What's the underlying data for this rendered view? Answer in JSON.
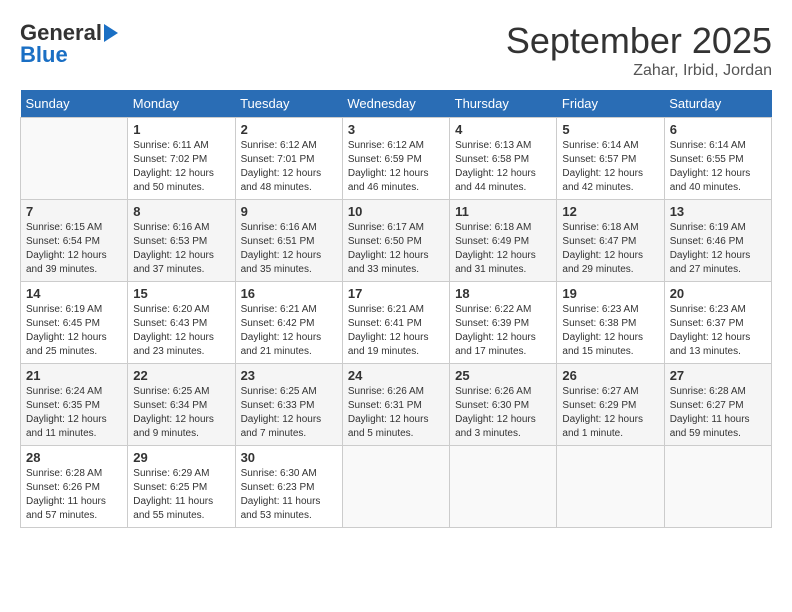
{
  "logo": {
    "line1": "General",
    "line2": "Blue"
  },
  "title": "September 2025",
  "subtitle": "Zahar, Irbid, Jordan",
  "days": [
    "Sunday",
    "Monday",
    "Tuesday",
    "Wednesday",
    "Thursday",
    "Friday",
    "Saturday"
  ],
  "weeks": [
    [
      {
        "num": "",
        "info": ""
      },
      {
        "num": "1",
        "info": "Sunrise: 6:11 AM\nSunset: 7:02 PM\nDaylight: 12 hours\nand 50 minutes."
      },
      {
        "num": "2",
        "info": "Sunrise: 6:12 AM\nSunset: 7:01 PM\nDaylight: 12 hours\nand 48 minutes."
      },
      {
        "num": "3",
        "info": "Sunrise: 6:12 AM\nSunset: 6:59 PM\nDaylight: 12 hours\nand 46 minutes."
      },
      {
        "num": "4",
        "info": "Sunrise: 6:13 AM\nSunset: 6:58 PM\nDaylight: 12 hours\nand 44 minutes."
      },
      {
        "num": "5",
        "info": "Sunrise: 6:14 AM\nSunset: 6:57 PM\nDaylight: 12 hours\nand 42 minutes."
      },
      {
        "num": "6",
        "info": "Sunrise: 6:14 AM\nSunset: 6:55 PM\nDaylight: 12 hours\nand 40 minutes."
      }
    ],
    [
      {
        "num": "7",
        "info": "Sunrise: 6:15 AM\nSunset: 6:54 PM\nDaylight: 12 hours\nand 39 minutes."
      },
      {
        "num": "8",
        "info": "Sunrise: 6:16 AM\nSunset: 6:53 PM\nDaylight: 12 hours\nand 37 minutes."
      },
      {
        "num": "9",
        "info": "Sunrise: 6:16 AM\nSunset: 6:51 PM\nDaylight: 12 hours\nand 35 minutes."
      },
      {
        "num": "10",
        "info": "Sunrise: 6:17 AM\nSunset: 6:50 PM\nDaylight: 12 hours\nand 33 minutes."
      },
      {
        "num": "11",
        "info": "Sunrise: 6:18 AM\nSunset: 6:49 PM\nDaylight: 12 hours\nand 31 minutes."
      },
      {
        "num": "12",
        "info": "Sunrise: 6:18 AM\nSunset: 6:47 PM\nDaylight: 12 hours\nand 29 minutes."
      },
      {
        "num": "13",
        "info": "Sunrise: 6:19 AM\nSunset: 6:46 PM\nDaylight: 12 hours\nand 27 minutes."
      }
    ],
    [
      {
        "num": "14",
        "info": "Sunrise: 6:19 AM\nSunset: 6:45 PM\nDaylight: 12 hours\nand 25 minutes."
      },
      {
        "num": "15",
        "info": "Sunrise: 6:20 AM\nSunset: 6:43 PM\nDaylight: 12 hours\nand 23 minutes."
      },
      {
        "num": "16",
        "info": "Sunrise: 6:21 AM\nSunset: 6:42 PM\nDaylight: 12 hours\nand 21 minutes."
      },
      {
        "num": "17",
        "info": "Sunrise: 6:21 AM\nSunset: 6:41 PM\nDaylight: 12 hours\nand 19 minutes."
      },
      {
        "num": "18",
        "info": "Sunrise: 6:22 AM\nSunset: 6:39 PM\nDaylight: 12 hours\nand 17 minutes."
      },
      {
        "num": "19",
        "info": "Sunrise: 6:23 AM\nSunset: 6:38 PM\nDaylight: 12 hours\nand 15 minutes."
      },
      {
        "num": "20",
        "info": "Sunrise: 6:23 AM\nSunset: 6:37 PM\nDaylight: 12 hours\nand 13 minutes."
      }
    ],
    [
      {
        "num": "21",
        "info": "Sunrise: 6:24 AM\nSunset: 6:35 PM\nDaylight: 12 hours\nand 11 minutes."
      },
      {
        "num": "22",
        "info": "Sunrise: 6:25 AM\nSunset: 6:34 PM\nDaylight: 12 hours\nand 9 minutes."
      },
      {
        "num": "23",
        "info": "Sunrise: 6:25 AM\nSunset: 6:33 PM\nDaylight: 12 hours\nand 7 minutes."
      },
      {
        "num": "24",
        "info": "Sunrise: 6:26 AM\nSunset: 6:31 PM\nDaylight: 12 hours\nand 5 minutes."
      },
      {
        "num": "25",
        "info": "Sunrise: 6:26 AM\nSunset: 6:30 PM\nDaylight: 12 hours\nand 3 minutes."
      },
      {
        "num": "26",
        "info": "Sunrise: 6:27 AM\nSunset: 6:29 PM\nDaylight: 12 hours\nand 1 minute."
      },
      {
        "num": "27",
        "info": "Sunrise: 6:28 AM\nSunset: 6:27 PM\nDaylight: 11 hours\nand 59 minutes."
      }
    ],
    [
      {
        "num": "28",
        "info": "Sunrise: 6:28 AM\nSunset: 6:26 PM\nDaylight: 11 hours\nand 57 minutes."
      },
      {
        "num": "29",
        "info": "Sunrise: 6:29 AM\nSunset: 6:25 PM\nDaylight: 11 hours\nand 55 minutes."
      },
      {
        "num": "30",
        "info": "Sunrise: 6:30 AM\nSunset: 6:23 PM\nDaylight: 11 hours\nand 53 minutes."
      },
      {
        "num": "",
        "info": ""
      },
      {
        "num": "",
        "info": ""
      },
      {
        "num": "",
        "info": ""
      },
      {
        "num": "",
        "info": ""
      }
    ]
  ]
}
